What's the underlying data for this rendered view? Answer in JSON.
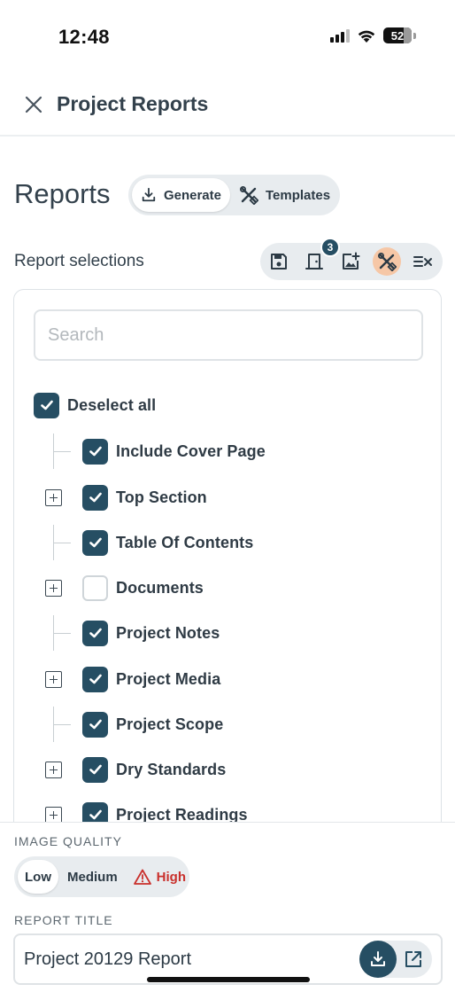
{
  "status_bar": {
    "time": "12:48",
    "battery": "52"
  },
  "header": {
    "title": "Project Reports"
  },
  "reports": {
    "title": "Reports",
    "tabs": [
      {
        "label": "Generate",
        "icon": "download-icon",
        "active": true
      },
      {
        "label": "Templates",
        "icon": "tools-icon",
        "active": false
      }
    ]
  },
  "selections": {
    "label": "Report selections",
    "toolbar": [
      {
        "icon": "save-icon"
      },
      {
        "icon": "door-icon",
        "badge": "3"
      },
      {
        "icon": "image-add-icon"
      },
      {
        "icon": "tools-icon",
        "highlighted": true
      },
      {
        "icon": "list-clear-icon"
      }
    ]
  },
  "search": {
    "placeholder": "Search",
    "value": ""
  },
  "deselect_all": {
    "label": "Deselect all",
    "checked": true
  },
  "items": [
    {
      "label": "Include Cover Page",
      "checked": true,
      "expandable": false
    },
    {
      "label": "Top Section",
      "checked": true,
      "expandable": true
    },
    {
      "label": "Table Of Contents",
      "checked": true,
      "expandable": false
    },
    {
      "label": "Documents",
      "checked": false,
      "expandable": true
    },
    {
      "label": "Project Notes",
      "checked": true,
      "expandable": false
    },
    {
      "label": "Project Media",
      "checked": true,
      "expandable": true
    },
    {
      "label": "Project Scope",
      "checked": true,
      "expandable": false
    },
    {
      "label": "Dry Standards",
      "checked": true,
      "expandable": true
    },
    {
      "label": "Project Readings",
      "checked": true,
      "expandable": true
    }
  ],
  "image_quality": {
    "label": "IMAGE QUALITY",
    "options": [
      {
        "label": "Low",
        "active": true
      },
      {
        "label": "Medium",
        "active": false
      },
      {
        "label": "High",
        "active": false,
        "warning": true
      }
    ]
  },
  "report_title": {
    "label": "REPORT TITLE",
    "value": "Project 20129 Report"
  },
  "colors": {
    "primary": "#264e63",
    "warning": "#c9302c",
    "highlight": "#f6c7a6"
  }
}
